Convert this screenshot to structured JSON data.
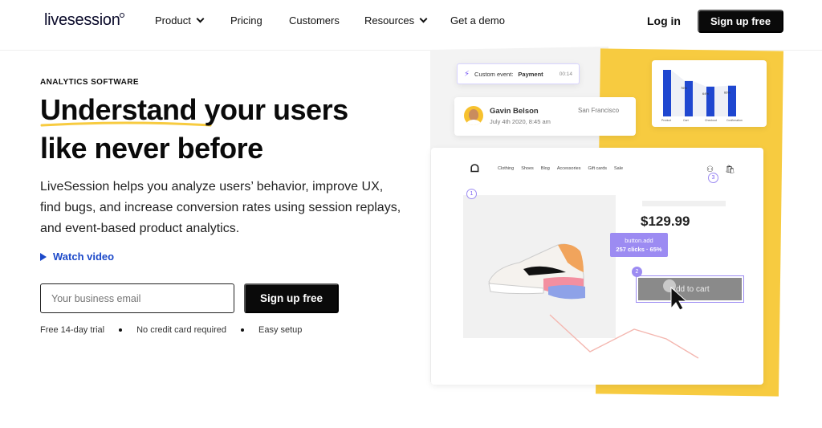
{
  "nav": {
    "logo": "livesession",
    "items": [
      {
        "label": "Product",
        "dropdown": true
      },
      {
        "label": "Pricing",
        "dropdown": false
      },
      {
        "label": "Customers",
        "dropdown": false
      },
      {
        "label": "Resources",
        "dropdown": true
      },
      {
        "label": "Get a demo",
        "dropdown": false
      }
    ],
    "login": "Log in",
    "signup": "Sign up free"
  },
  "hero": {
    "eyebrow": "ANALYTICS SOFTWARE",
    "title_word1": "Understand",
    "title_rest1": " your users",
    "title_line2": "like never before",
    "subtitle": "LiveSession helps you analyze users’ behavior, improve UX, find bugs, and increase conversion rates using session replays, and event-based product analytics.",
    "watch_video": "Watch video",
    "email_placeholder": "Your business email",
    "signup": "Sign up free",
    "perks": [
      "Free 14-day trial",
      "No credit card required",
      "Easy setup"
    ]
  },
  "illustration": {
    "event": {
      "prefix": "Custom event:",
      "name": "Payment",
      "time": "00:14"
    },
    "user": {
      "name": "Gavin Belson",
      "date": "July 4th 2020, 8:45 am",
      "city": "San Francisco"
    },
    "shop_menu": [
      "Clothing",
      "Shoes",
      "Blog",
      "Accessories",
      "Gift cards",
      "Sale"
    ],
    "price": "$129.99",
    "tooltip_line1": "button.add",
    "tooltip_line2": "257 clicks · 65%",
    "cart_button": "Add to cart",
    "badges": [
      "1",
      "2",
      "3"
    ]
  },
  "chart_data": {
    "type": "bar",
    "categories": [
      "Product",
      "Cart",
      "Checkout",
      "Confirmation"
    ],
    "values": [
      100,
      76,
      64,
      66
    ],
    "labels": [
      "",
      "76%",
      "64%",
      "66%"
    ],
    "color": "#1f47d0"
  }
}
